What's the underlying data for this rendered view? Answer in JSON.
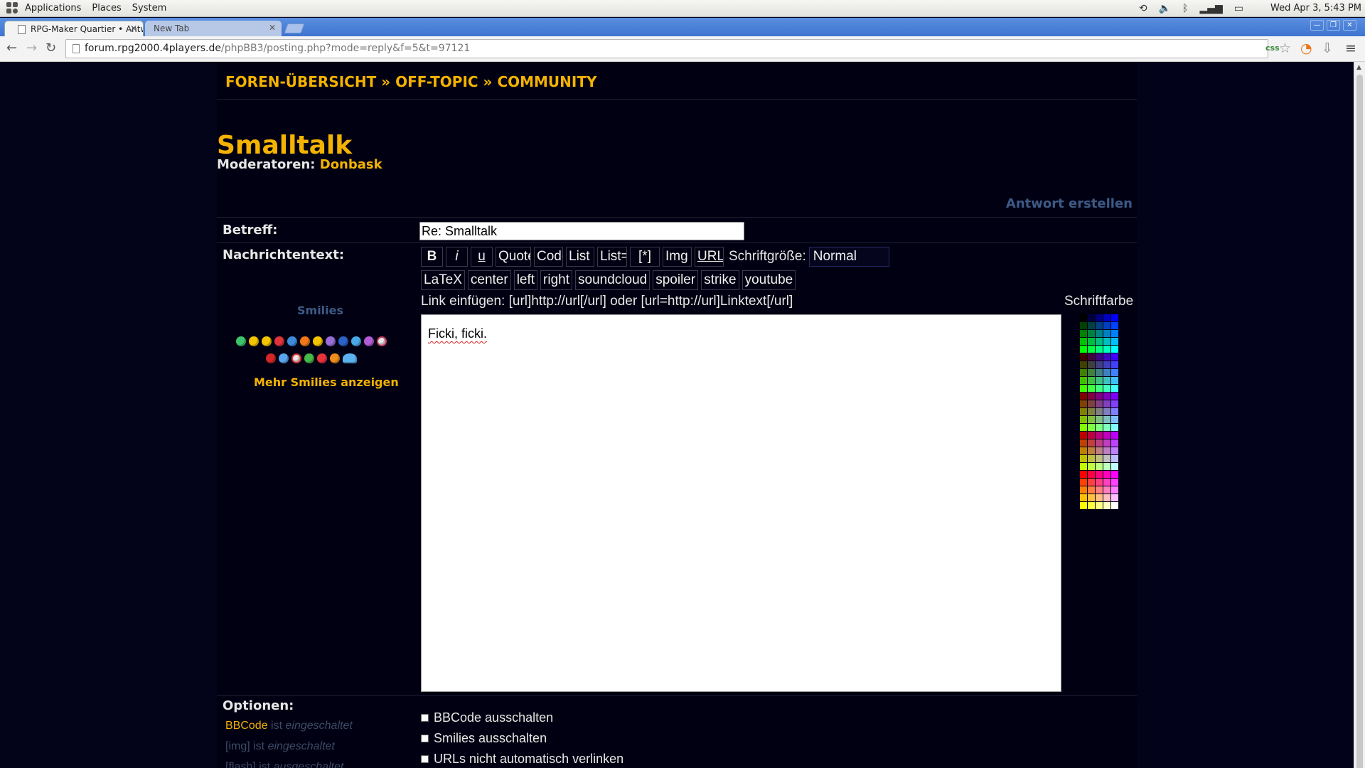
{
  "panel": {
    "menus": [
      "Applications",
      "Places",
      "System"
    ],
    "clock": "Wed Apr  3,  5:43 PM",
    "tray_icons": [
      "sync-icon",
      "volume-icon",
      "bluetooth-icon",
      "signal-icon",
      "battery-icon"
    ]
  },
  "browser": {
    "tabs": [
      {
        "title": "RPG-Maker Quartier • Antw",
        "active": true
      },
      {
        "title": "New Tab",
        "active": false
      }
    ],
    "url_host": "forum.rpg2000.4players.de",
    "url_path": "/phpBB3/posting.php?mode=reply&f=5&t=97121",
    "css_badge": "css"
  },
  "forum": {
    "breadcrumb": [
      "FOREN-ÜBERSICHT",
      "OFF-TOPIC",
      "COMMUNITY"
    ],
    "breadcrumb_sep": "»",
    "title": "Smalltalk",
    "moderators_label": "Moderatoren:",
    "moderator": "Donbask",
    "post_heading": "Antwort erstellen",
    "subject_label": "Betreff:",
    "subject_value": "Re: Smalltalk",
    "message_label": "Nachrichtentext:",
    "bbcode_row1": [
      "B",
      "i",
      "u",
      "Quote",
      "Code",
      "List",
      "List=",
      "[*]",
      "Img",
      "URL"
    ],
    "bbcode_row2": [
      "LaTeX",
      "center",
      "left",
      "right",
      "soundcloud",
      "spoiler",
      "strike",
      "youtube"
    ],
    "font_size_label": "Schriftgröße:",
    "font_size_value": "Normal",
    "link_hint": "Link einfügen: [url]http://url[/url] oder [url=http://url]Linktext[/url]",
    "color_label": "Schriftfarbe",
    "smilies_heading": "Smilies",
    "more_smilies": "Mehr Smilies anzeigen",
    "message_text": "Ficki, ficki.",
    "options_label": "Optionen:",
    "status": [
      {
        "link": "BBCode",
        "text": "ist",
        "state": "eingeschaltet"
      },
      {
        "link": "[img]",
        "text": "ist",
        "state": "eingeschaltet"
      },
      {
        "link": "[flash]",
        "text": "ist",
        "state": "ausgeschaltet"
      }
    ],
    "checkboxes": [
      "BBCode ausschalten",
      "Smilies ausschalten",
      "URLs nicht automatisch verlinken"
    ]
  },
  "colors": {
    "accent": "#f4b300",
    "muted_heading": "#3d5a86",
    "page_bg": "#000012"
  }
}
